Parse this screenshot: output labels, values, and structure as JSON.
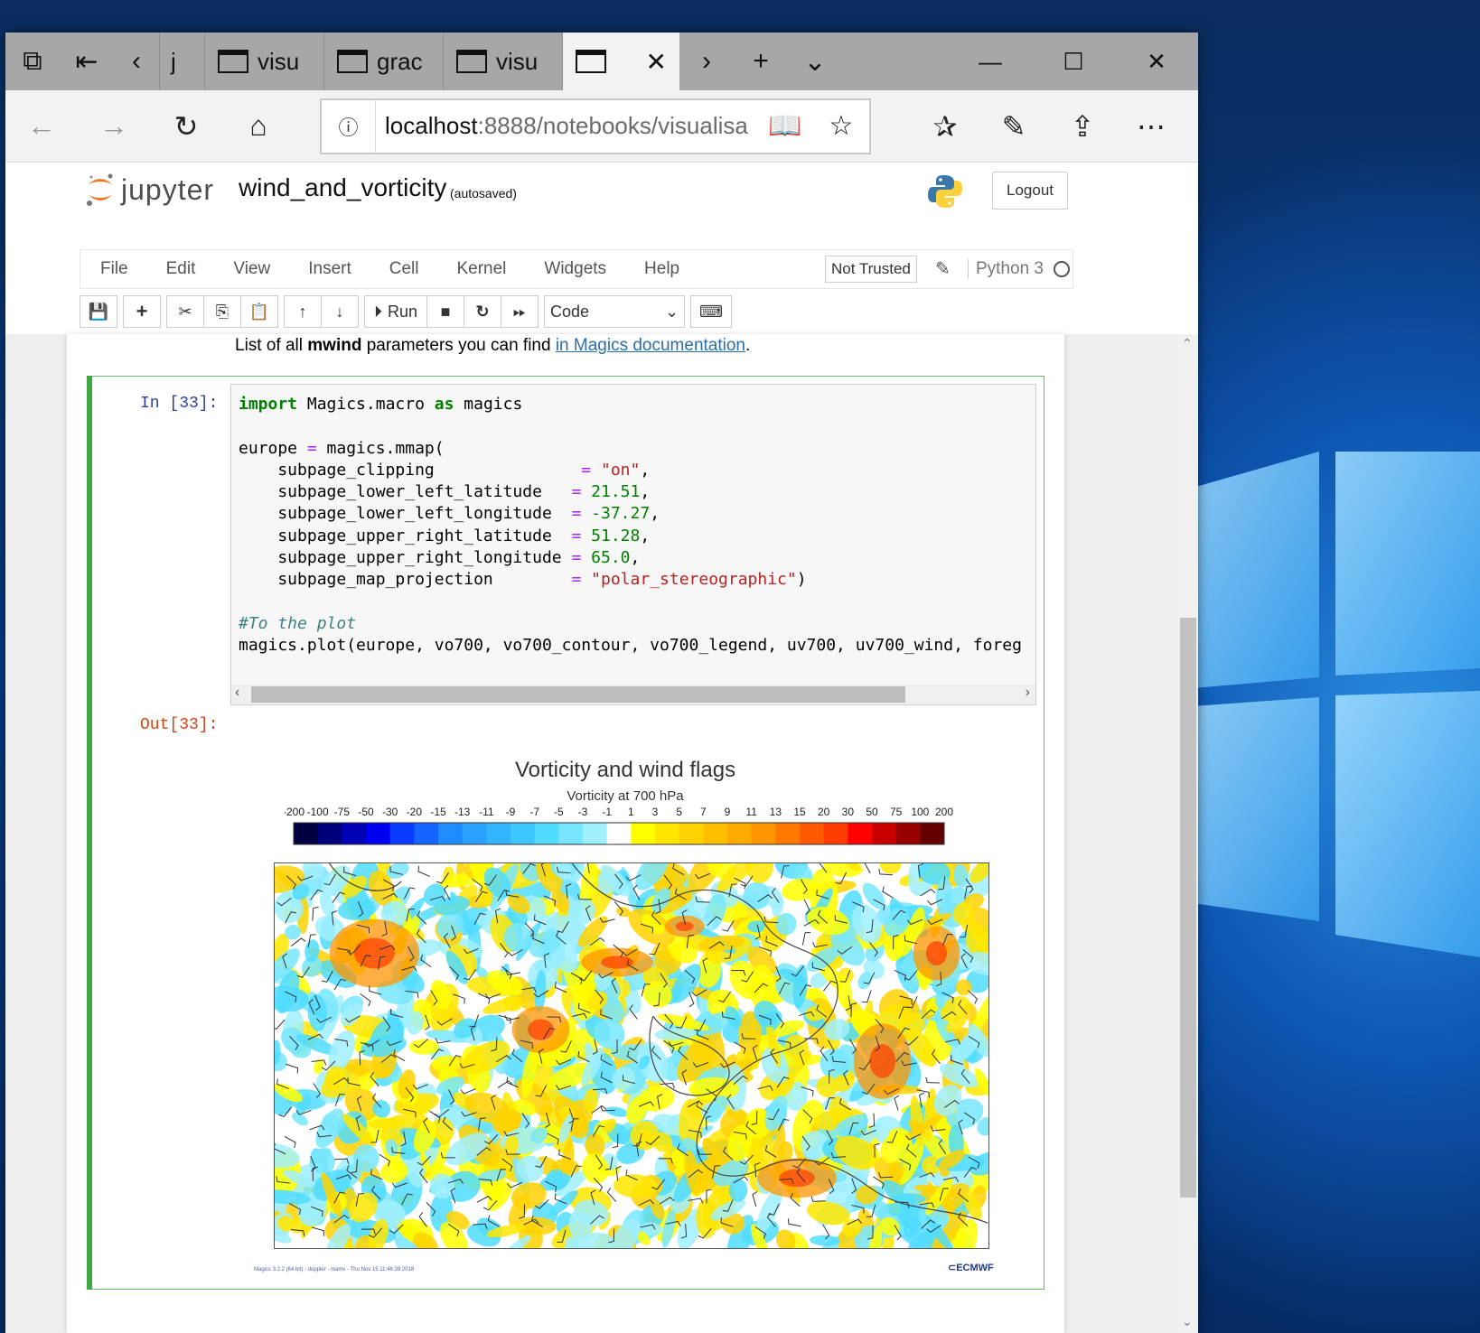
{
  "browser": {
    "tabs": [
      {
        "label": "j"
      },
      {
        "label": "visu"
      },
      {
        "label": "grac"
      },
      {
        "label": "visu"
      }
    ],
    "address": {
      "host": "localhost",
      "path": ":8888/notebooks/visualisa"
    }
  },
  "jupyter": {
    "logo_text": "jupyter",
    "notebook_name": "wind_and_vorticity",
    "autosave_status": "(autosaved)",
    "logout_label": "Logout",
    "menu": [
      "File",
      "Edit",
      "View",
      "Insert",
      "Cell",
      "Kernel",
      "Widgets",
      "Help"
    ],
    "trust_label": "Not Trusted",
    "kernel_name": "Python 3",
    "toolbar": {
      "run_label": "Run",
      "cell_type": "Code"
    }
  },
  "notebook": {
    "markdown": {
      "prefix": "List of all ",
      "bold": "mwind",
      "middle": " parameters you can find ",
      "link": "in Magics documentation",
      "suffix": "."
    },
    "cell": {
      "in_prompt": "In [33]:",
      "out_prompt": "Out[33]:",
      "code_lines": {
        "l1_kw": "import",
        "l1_mid": " Magics.macro ",
        "l1_kw2": "as",
        "l1_end": " magics",
        "l3_a": "europe ",
        "l3_op": "=",
        "l3_b": " magics.mmap(",
        "l4_a": "    subpage_clipping               ",
        "l4_op": "=",
        "l4_v": "\"on\"",
        "l4_e": ",",
        "l5_a": "    subpage_lower_left_latitude   ",
        "l5_op": "=",
        "l5_v": "21.51",
        "l5_e": ",",
        "l6_a": "    subpage_lower_left_longitude  ",
        "l6_op": "=",
        "l6_v": "-37.27",
        "l6_e": ",",
        "l7_a": "    subpage_upper_right_latitude  ",
        "l7_op": "=",
        "l7_v": "51.28",
        "l7_e": ",",
        "l8_a": "    subpage_upper_right_longitude ",
        "l8_op": "=",
        "l8_v": "65.0",
        "l8_e": ",",
        "l9_a": "    subpage_map_projection        ",
        "l9_op": "=",
        "l9_v": "\"polar_stereographic\"",
        "l9_e": ")",
        "l11_cm": "#To the plot",
        "l12": "magics.plot(europe, vo700, vo700_contour, vo700_legend, uv700, uv700_wind, foreg"
      }
    },
    "figure": {
      "title": "Vorticity and wind flags",
      "legend_title": "Vorticity at 700 hPa",
      "legend_labels": [
        "-200",
        "-100",
        "-75",
        "-50",
        "-30",
        "-20",
        "-15",
        "-13",
        "-11",
        "-9",
        "-7",
        "-5",
        "-3",
        "-1",
        "1",
        "3",
        "5",
        "7",
        "9",
        "11",
        "13",
        "15",
        "20",
        "30",
        "50",
        "75",
        "100",
        "200"
      ],
      "legend_colors": [
        "#000040",
        "#00007a",
        "#0000b5",
        "#0000f0",
        "#0a3cff",
        "#1464ff",
        "#1e8cff",
        "#28a0ff",
        "#32b4ff",
        "#3cc8ff",
        "#50dcff",
        "#78e6ff",
        "#a0f0ff",
        "#ffffff",
        "#ffff00",
        "#ffe600",
        "#ffd200",
        "#ffbe00",
        "#ffaa00",
        "#ff9600",
        "#ff7800",
        "#ff5a00",
        "#ff3c00",
        "#ff0000",
        "#c80000",
        "#960000",
        "#640000"
      ],
      "footer_left": "Magics 3.2.2 (64 bit) - doppler - mamv - Thu Nov 15 11:46:39 2018",
      "footer_right": "ECMWF"
    }
  }
}
